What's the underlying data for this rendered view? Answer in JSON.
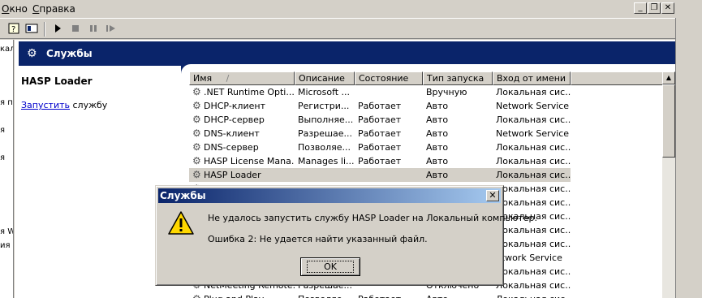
{
  "menubar": {
    "items": [
      {
        "label": "Окно",
        "u": "О"
      },
      {
        "label": "Справка",
        "u": "С"
      }
    ],
    "window_buttons": [
      "_",
      "❐",
      "✕"
    ]
  },
  "toolbar": {
    "icons": [
      "help-icon",
      "view-icon",
      "play-icon",
      "stop-icon",
      "pause-icon",
      "restart-icon"
    ]
  },
  "tree": {
    "fragments": [
      "кал",
      "я пр",
      "я",
      "я",
      "я WM",
      "ия"
    ]
  },
  "header": {
    "title": "Службы"
  },
  "selected_service": {
    "name": "HASP Loader",
    "action_link": "Запустить",
    "action_suffix": " службу"
  },
  "listview": {
    "columns": [
      "Имя",
      "Описание",
      "Состояние",
      "Тип запуска",
      "Вход от имени"
    ],
    "sort_indicator": "/",
    "rows": [
      [
        ".NET Runtime Opti...",
        "Microsoft ...",
        "",
        "Вручную",
        "Локальная сис..."
      ],
      [
        "DHCP-клиент",
        "Регистри...",
        "Работает",
        "Авто",
        "Network Service"
      ],
      [
        "DHCP-сервер",
        "Выполняе...",
        "Работает",
        "Авто",
        "Локальная сис..."
      ],
      [
        "DNS-клиент",
        "Разрешае...",
        "Работает",
        "Авто",
        "Network Service"
      ],
      [
        "DNS-сервер",
        "Позволяе...",
        "Работает",
        "Авто",
        "Локальная сис..."
      ],
      [
        "HASP License Mana...",
        "Manages li...",
        "Работает",
        "Авто",
        "Локальная сис..."
      ],
      [
        "HASP Loader",
        "",
        "",
        "Авто",
        "Локальная сис..."
      ],
      [
        "",
        "",
        "",
        "",
        "Локальная сис..."
      ],
      [
        "",
        "",
        "",
        "",
        "Локальная сис..."
      ],
      [
        "",
        "",
        "",
        "",
        "Локальная сис..."
      ],
      [
        "",
        "",
        "",
        "",
        "Локальная сис..."
      ],
      [
        "",
        "",
        "",
        "",
        "Локальная сис..."
      ],
      [
        "",
        "",
        "",
        "",
        "etwork Service"
      ],
      [
        "",
        "",
        "",
        "",
        "Локальная сис..."
      ],
      [
        "NetMeeting Remote...",
        "Разрешае...",
        "",
        "Отключено",
        "Локальная сис..."
      ],
      [
        "Plug and Play",
        "Позволяе...",
        "Работает",
        "Авто",
        "Локальная сис..."
      ]
    ],
    "selected_row": 6
  },
  "dialog": {
    "title": "Службы",
    "message1": "Не удалось запустить службу HASP Loader на Локальный компьютер.",
    "message2": "Ошибка 2: Не удается найти указанный файл.",
    "ok_label": "OK"
  },
  "colors": {
    "titlebar": "#0a246a",
    "face": "#d4d0c8"
  }
}
